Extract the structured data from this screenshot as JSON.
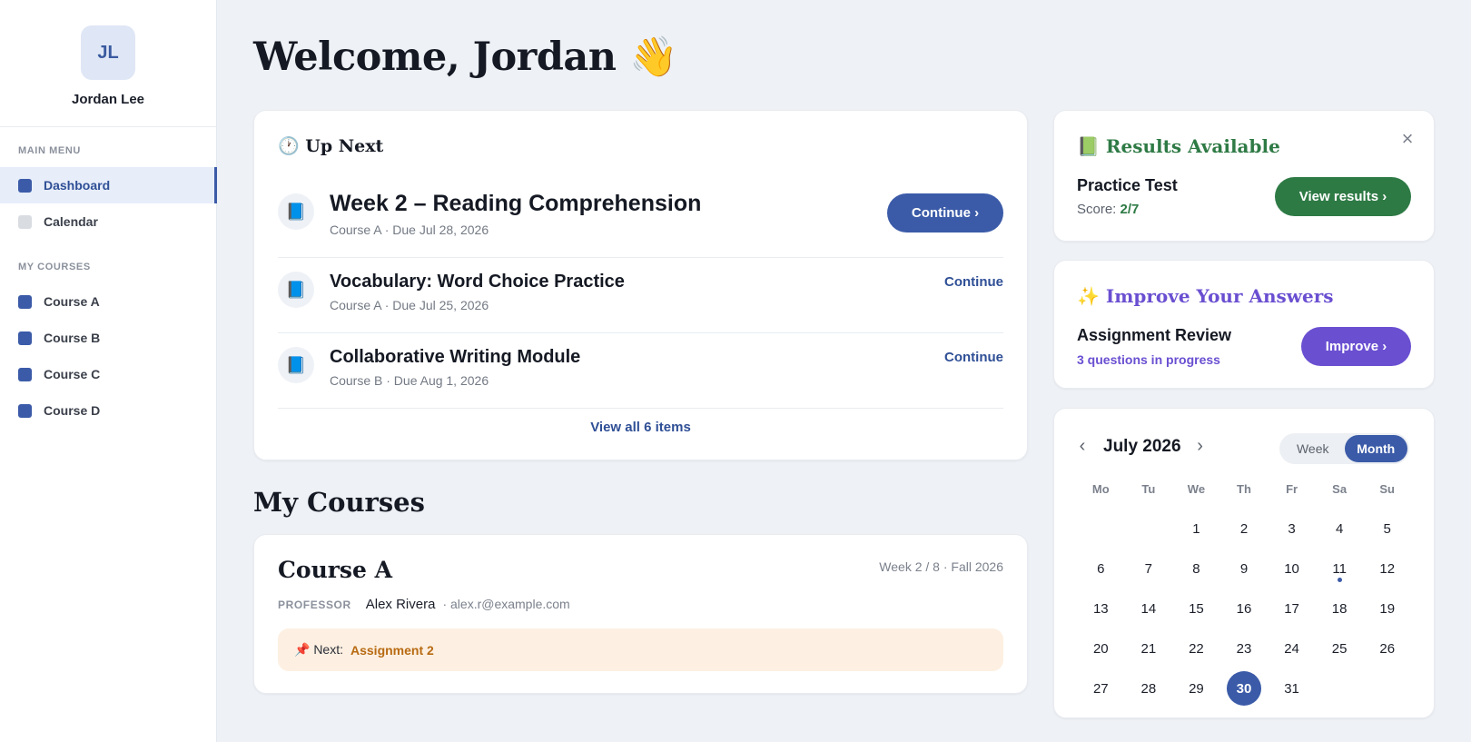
{
  "user": {
    "initials": "JL",
    "name": "Jordan Lee"
  },
  "sidebar": {
    "main_menu_label": "MAIN MENU",
    "main_items": [
      {
        "label": "Dashboard",
        "active": true
      },
      {
        "label": "Calendar",
        "active": false
      }
    ],
    "courses_label": "MY COURSES",
    "course_items": [
      {
        "label": "Course A"
      },
      {
        "label": "Course B"
      },
      {
        "label": "Course C"
      },
      {
        "label": "Course D"
      }
    ]
  },
  "header": {
    "welcome": "Welcome, Jordan 👋"
  },
  "up_next": {
    "title": "🕐 Up Next",
    "items": [
      {
        "icon": "📘",
        "title": "Week 2 – Reading Comprehension",
        "meta": "Course A · Due Jul 28, 2026",
        "action": "Continue ›"
      },
      {
        "icon": "📘",
        "title": "Vocabulary: Word Choice Practice",
        "meta": "Course A · Due Jul 25, 2026",
        "action": "Continue"
      },
      {
        "icon": "📘",
        "title": "Collaborative Writing Module",
        "meta": "Course B · Due Aug 1, 2026",
        "action": "Continue"
      }
    ],
    "view_all": "View all 6 items"
  },
  "my_courses": {
    "heading": "My Courses",
    "course": {
      "title": "Course A",
      "meta": "Week 2 / 8 · Fall 2026",
      "professor_label": "PROFESSOR",
      "professor_name": "Alex Rivera",
      "professor_email": "· alex.r@example.com",
      "next_label": "📌 Next:",
      "next_value": "Assignment 2"
    }
  },
  "results": {
    "title": "📗 Results Available",
    "item": "Practice Test",
    "score_label": "Score:",
    "score_value": "2/7",
    "button": "View results ›",
    "close": "×"
  },
  "improve": {
    "title": "✨ Improve Your Answers",
    "item": "Assignment Review",
    "sub": "3 questions in progress",
    "button": "Improve ›"
  },
  "calendar": {
    "month": "July 2026",
    "prev": "‹",
    "next": "›",
    "view_week": "Week",
    "view_month": "Month",
    "weekdays": [
      "Mo",
      "Tu",
      "We",
      "Th",
      "Fr",
      "Sa",
      "Su"
    ],
    "days": [
      "",
      "",
      "1",
      "2",
      "3",
      "4",
      "5",
      "6",
      "7",
      "8",
      "9",
      "10",
      "11",
      "12",
      "13",
      "14",
      "15",
      "16",
      "17",
      "18",
      "19",
      "20",
      "21",
      "22",
      "23",
      "24",
      "25",
      "26",
      "27",
      "28",
      "29",
      "30",
      "31"
    ],
    "today": "30",
    "event_days": [
      "11"
    ]
  },
  "colors": {
    "accent": "#3b5ba8",
    "results_green": "#2e7a45",
    "improve_purple": "#6a4fd1",
    "next_orange": "#b86a12"
  }
}
